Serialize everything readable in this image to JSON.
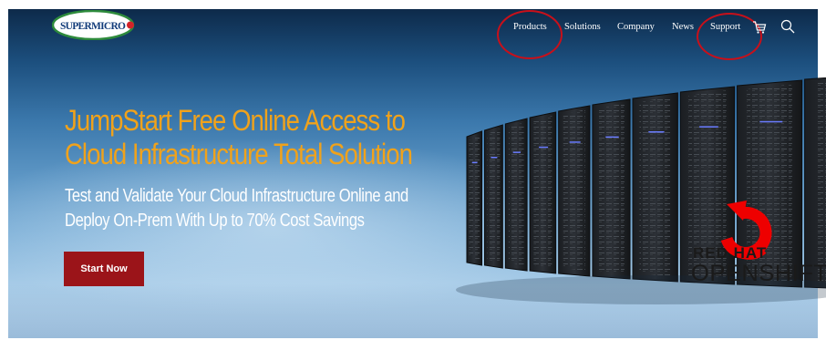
{
  "brand": {
    "logo_text": "SUPERMICRO"
  },
  "nav": {
    "items": [
      {
        "label": "Products",
        "highlighted": true
      },
      {
        "label": "Solutions",
        "highlighted": false
      },
      {
        "label": "Company",
        "highlighted": false
      },
      {
        "label": "News",
        "highlighted": false
      },
      {
        "label": "Support",
        "highlighted": true
      }
    ],
    "icons": [
      "cart-icon",
      "search-icon"
    ],
    "highlight_color": "#c8101a"
  },
  "hero": {
    "headline_line1": "JumpStart Free Online Access to",
    "headline_line2": "Cloud Infrastructure Total Solution",
    "subline_line1": "Test and Validate Your Cloud Infrastructure Online and",
    "subline_line2": "Deploy On-Prem With Up to 70% Cost Savings",
    "cta_label": "Start Now",
    "headline_color": "#f0a21b",
    "cta_color": "#9b1419"
  },
  "partner_logo": {
    "line1": "RED HAT",
    "line2": "OPENSHIFT",
    "accent": "#ee0000"
  }
}
